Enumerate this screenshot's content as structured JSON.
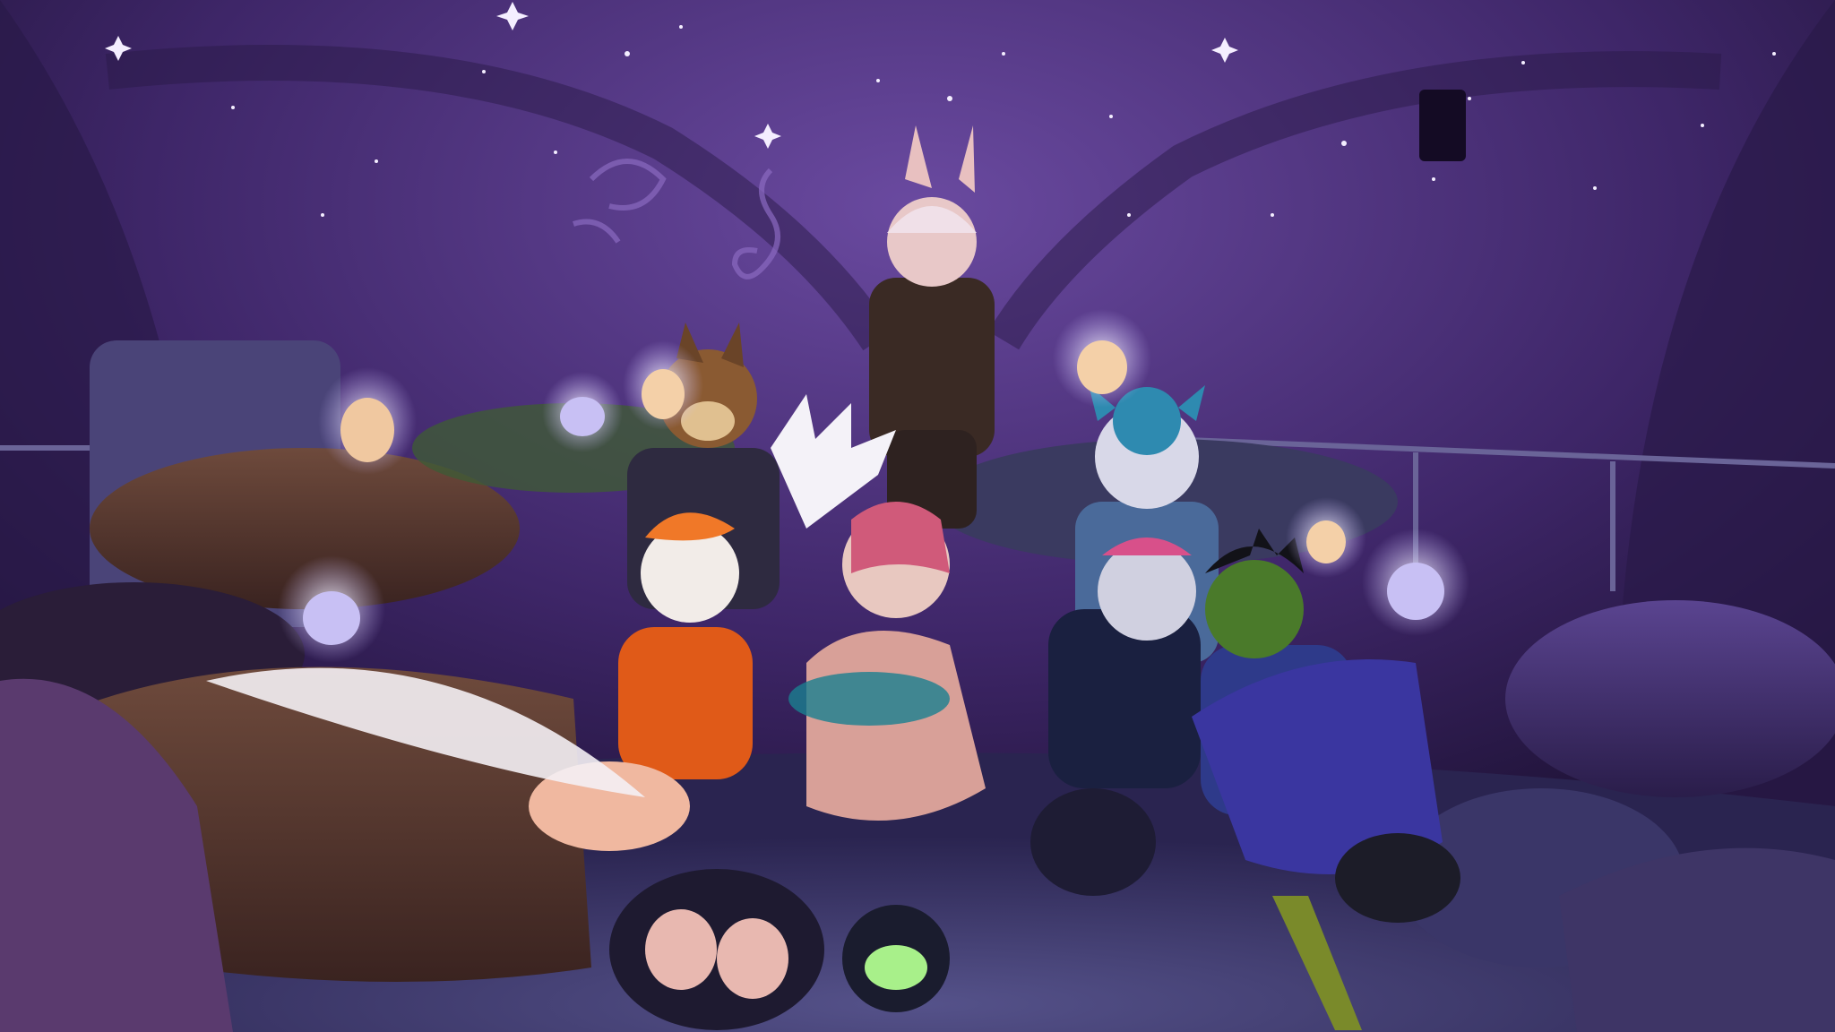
{
  "scene": {
    "kind": "vr-group-photo",
    "setting": "purple-starry-dome-room",
    "colors": {
      "ceiling": "#4a2f78",
      "wall": "#3a2560",
      "floor": "#3e3a6e",
      "pillow_brown": "#5a3a32",
      "pillow_purple": "#4a3670",
      "glow": "#f4f0ff",
      "accent_cyan": "#4fd8e8",
      "accent_lime": "#b8ff6a"
    },
    "icons": [
      "star-sparkle-icon",
      "music-note-icon"
    ]
  }
}
